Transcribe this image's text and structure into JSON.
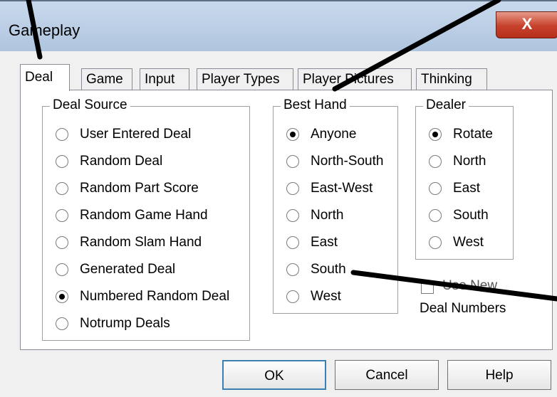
{
  "window": {
    "title": "Gameplay",
    "close_label": "X"
  },
  "tabs": [
    {
      "label": "Deal",
      "active": true
    },
    {
      "label": "Game",
      "active": false
    },
    {
      "label": "Input",
      "active": false
    },
    {
      "label": "Player Types",
      "active": false
    },
    {
      "label": "Player Pictures",
      "active": false
    },
    {
      "label": "Thinking",
      "active": false
    }
  ],
  "deal_source": {
    "label": "Deal Source",
    "options": [
      {
        "label": "User Entered Deal",
        "checked": false
      },
      {
        "label": "Random Deal",
        "checked": false
      },
      {
        "label": "Random Part Score",
        "checked": false
      },
      {
        "label": "Random Game Hand",
        "checked": false
      },
      {
        "label": "Random Slam Hand",
        "checked": false
      },
      {
        "label": "Generated Deal",
        "checked": false
      },
      {
        "label": "Numbered Random Deal",
        "checked": true
      },
      {
        "label": "Notrump Deals",
        "checked": false
      }
    ]
  },
  "best_hand": {
    "label": "Best Hand",
    "options": [
      {
        "label": "Anyone",
        "checked": true
      },
      {
        "label": "North-South",
        "checked": false
      },
      {
        "label": "East-West",
        "checked": false
      },
      {
        "label": "North",
        "checked": false
      },
      {
        "label": "East",
        "checked": false
      },
      {
        "label": "South",
        "checked": false
      },
      {
        "label": "West",
        "checked": false
      }
    ]
  },
  "dealer": {
    "label": "Dealer",
    "options": [
      {
        "label": "Rotate",
        "checked": true
      },
      {
        "label": "North",
        "checked": false
      },
      {
        "label": "East",
        "checked": false
      },
      {
        "label": "South",
        "checked": false
      },
      {
        "label": "West",
        "checked": false
      }
    ]
  },
  "deal_numbers": {
    "checkbox_label": "Use New",
    "label": "Deal Numbers",
    "checked": false
  },
  "buttons": {
    "ok": "OK",
    "cancel": "Cancel",
    "help": "Help"
  }
}
